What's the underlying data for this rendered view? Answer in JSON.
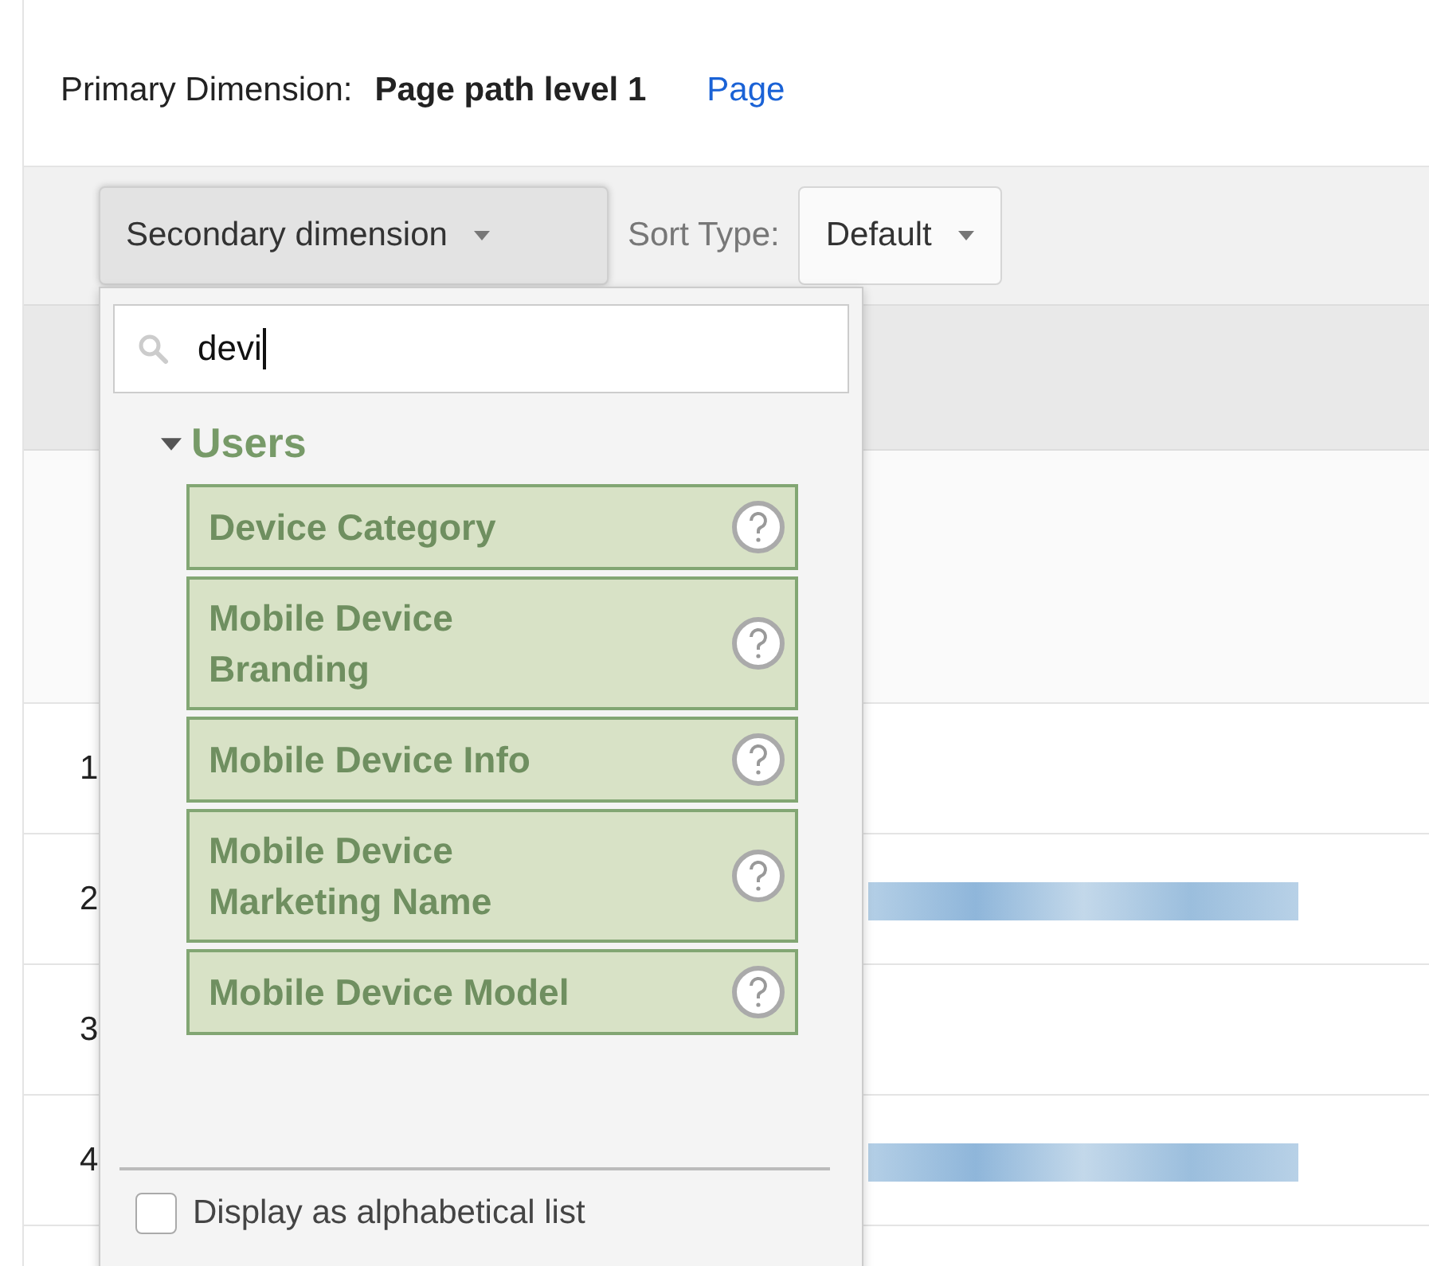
{
  "primary_dimension": {
    "label": "Primary Dimension:",
    "value": "Page path level 1",
    "link": "Page"
  },
  "toolbar": {
    "secondary_dimension": "Secondary dimension",
    "sort_label": "Sort Type:",
    "sort_value": "Default"
  },
  "dropdown": {
    "search": {
      "value": "devi"
    },
    "group": {
      "label": "Users",
      "expanded": true
    },
    "items": [
      {
        "label": "Device Category"
      },
      {
        "label": "Mobile Device Branding"
      },
      {
        "label": "Mobile Device Info"
      },
      {
        "label": "Mobile Device Marketing Name"
      },
      {
        "label": "Mobile Device Model"
      }
    ],
    "alphabetical": {
      "label": "Display as alphabetical list",
      "checked": false
    }
  },
  "rows": [
    {
      "number": "1",
      "blurred": false
    },
    {
      "number": "2",
      "blurred": true
    },
    {
      "number": "3",
      "blurred": false
    },
    {
      "number": "4",
      "blurred": true
    }
  ]
}
